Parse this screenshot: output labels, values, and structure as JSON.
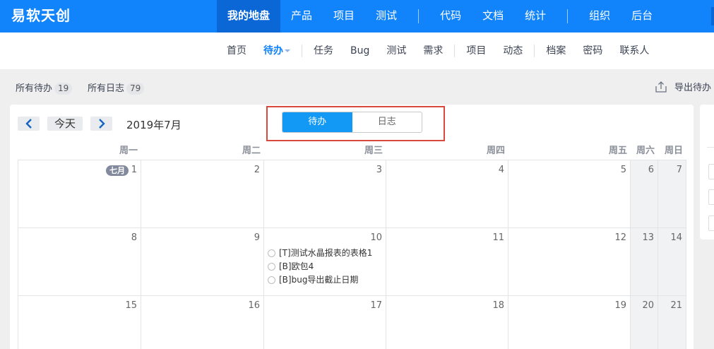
{
  "app": {
    "brand": "易软天创"
  },
  "main_nav": [
    {
      "label": "我的地盘",
      "active": true
    },
    {
      "label": "产品"
    },
    {
      "label": "项目"
    },
    {
      "label": "测试"
    },
    {
      "sep": true
    },
    {
      "label": "代码"
    },
    {
      "label": "文档"
    },
    {
      "label": "统计"
    },
    {
      "sep": true
    },
    {
      "label": "组织"
    },
    {
      "label": "后台"
    }
  ],
  "sub_nav": [
    {
      "label": "首页"
    },
    {
      "label": "待办",
      "active": true,
      "dropdown": true
    },
    {
      "sep": true
    },
    {
      "label": "任务"
    },
    {
      "label": "Bug"
    },
    {
      "label": "测试"
    },
    {
      "label": "需求"
    },
    {
      "sep": true
    },
    {
      "label": "项目"
    },
    {
      "label": "动态"
    },
    {
      "sep": true
    },
    {
      "label": "档案"
    },
    {
      "label": "密码"
    },
    {
      "label": "联系人"
    }
  ],
  "filters": {
    "all_todo": {
      "label": "所有待办",
      "count": "19"
    },
    "all_log": {
      "label": "所有日志",
      "count": "79"
    },
    "export": {
      "label": "导出待办",
      "icon": "export-icon"
    }
  },
  "calendar": {
    "prev_icon": "chevron-left-icon",
    "next_icon": "chevron-right-icon",
    "today_label": "今天",
    "month_title": "2019年7月",
    "toggle": {
      "todo": "待办",
      "log": "日志",
      "selected": "todo"
    },
    "weekdays": [
      "周一",
      "周二",
      "周三",
      "周四",
      "周五",
      "周六",
      "周日"
    ],
    "month_badge": "七月",
    "weeks": [
      [
        "1",
        "2",
        "3",
        "4",
        "5",
        "6",
        "7"
      ],
      [
        "8",
        "9",
        "10",
        "11",
        "12",
        "13",
        "14"
      ],
      [
        "15",
        "16",
        "17",
        "18",
        "19",
        "20",
        "21"
      ]
    ],
    "events": {
      "10": [
        "[T]测试水晶报表的表格1",
        "[B]欧包4",
        "[B]bug导出截止日期"
      ]
    }
  },
  "colors": {
    "topbar": "#1183fb",
    "active_nav": "#0b67d6",
    "accent": "#1199f5",
    "highlight_border": "#d94a3d",
    "weekend_bg": "#f1f2f3"
  }
}
